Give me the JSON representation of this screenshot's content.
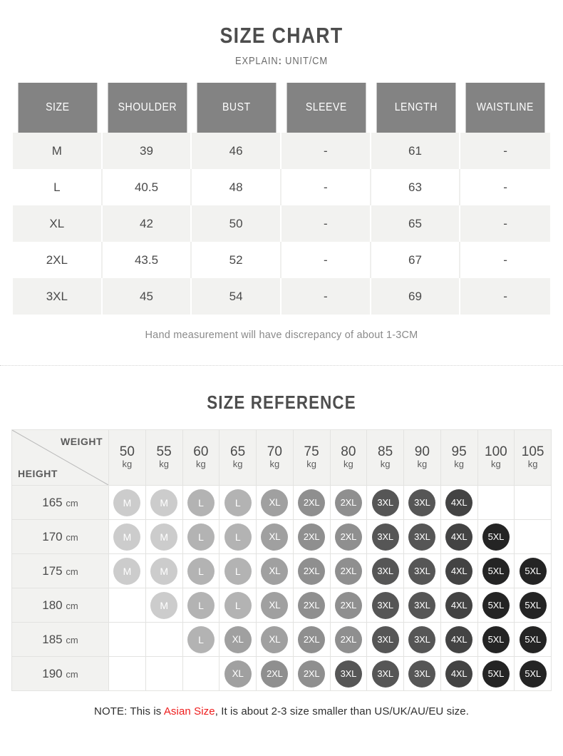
{
  "header": {
    "title": "SIZE CHART",
    "explain_label": "EXPLAIN",
    "explain_colon": ":",
    "explain_value": "UNIT/CM"
  },
  "size_chart": {
    "columns": [
      "SIZE",
      "SHOULDER",
      "BUST",
      "SLEEVE",
      "LENGTH",
      "WAISTLINE"
    ],
    "rows": [
      {
        "size": "M",
        "shoulder": "39",
        "bust": "46",
        "sleeve": "-",
        "length": "61",
        "waistline": "-"
      },
      {
        "size": "L",
        "shoulder": "40.5",
        "bust": "48",
        "sleeve": "-",
        "length": "63",
        "waistline": "-"
      },
      {
        "size": "XL",
        "shoulder": "42",
        "bust": "50",
        "sleeve": "-",
        "length": "65",
        "waistline": "-"
      },
      {
        "size": "2XL",
        "shoulder": "43.5",
        "bust": "52",
        "sleeve": "-",
        "length": "67",
        "waistline": "-"
      },
      {
        "size": "3XL",
        "shoulder": "45",
        "bust": "54",
        "sleeve": "-",
        "length": "69",
        "waistline": "-"
      }
    ],
    "footnote": "Hand measurement will have discrepancy of about 1-3CM"
  },
  "size_reference": {
    "title": "SIZE REFERENCE",
    "weight_label": "WEIGHT",
    "height_label": "HEIGHT",
    "weight_unit": "kg",
    "height_unit": "cm",
    "weights": [
      "50",
      "55",
      "60",
      "65",
      "70",
      "75",
      "80",
      "85",
      "90",
      "95",
      "100",
      "105"
    ],
    "heights": [
      "165",
      "170",
      "175",
      "180",
      "185",
      "190"
    ],
    "matrix": [
      [
        "M",
        "M",
        "L",
        "L",
        "XL",
        "2XL",
        "2XL",
        "3XL",
        "3XL",
        "4XL",
        "",
        ""
      ],
      [
        "M",
        "M",
        "L",
        "L",
        "XL",
        "2XL",
        "2XL",
        "3XL",
        "3XL",
        "4XL",
        "5XL",
        ""
      ],
      [
        "M",
        "M",
        "L",
        "L",
        "XL",
        "2XL",
        "2XL",
        "3XL",
        "3XL",
        "4XL",
        "5XL",
        "5XL"
      ],
      [
        "",
        "M",
        "L",
        "L",
        "XL",
        "2XL",
        "2XL",
        "3XL",
        "3XL",
        "4XL",
        "5XL",
        "5XL"
      ],
      [
        "",
        "",
        "L",
        "XL",
        "XL",
        "2XL",
        "2XL",
        "3XL",
        "3XL",
        "4XL",
        "5XL",
        "5XL"
      ],
      [
        "",
        "",
        "",
        "XL",
        "2XL",
        "2XL",
        "3XL",
        "3XL",
        "3XL",
        "4XL",
        "5XL",
        "5XL"
      ]
    ]
  },
  "bottom_note": {
    "prefix": "NOTE: This is ",
    "highlight": "Asian Size",
    "suffix": ", It is about 2-3 size smaller than US/UK/AU/EU size."
  },
  "colors": {
    "header_bg": "#838383",
    "row_alt_bg": "#f2f2f0",
    "highlight_red": "#ee1c1c",
    "bubble_M": "#cccccc",
    "bubble_L": "#b3b3b3",
    "bubble_XL": "#a0a0a0",
    "bubble_2XL": "#8f8f8f",
    "bubble_3XL": "#565656",
    "bubble_4XL": "#434343",
    "bubble_5XL": "#242424"
  }
}
